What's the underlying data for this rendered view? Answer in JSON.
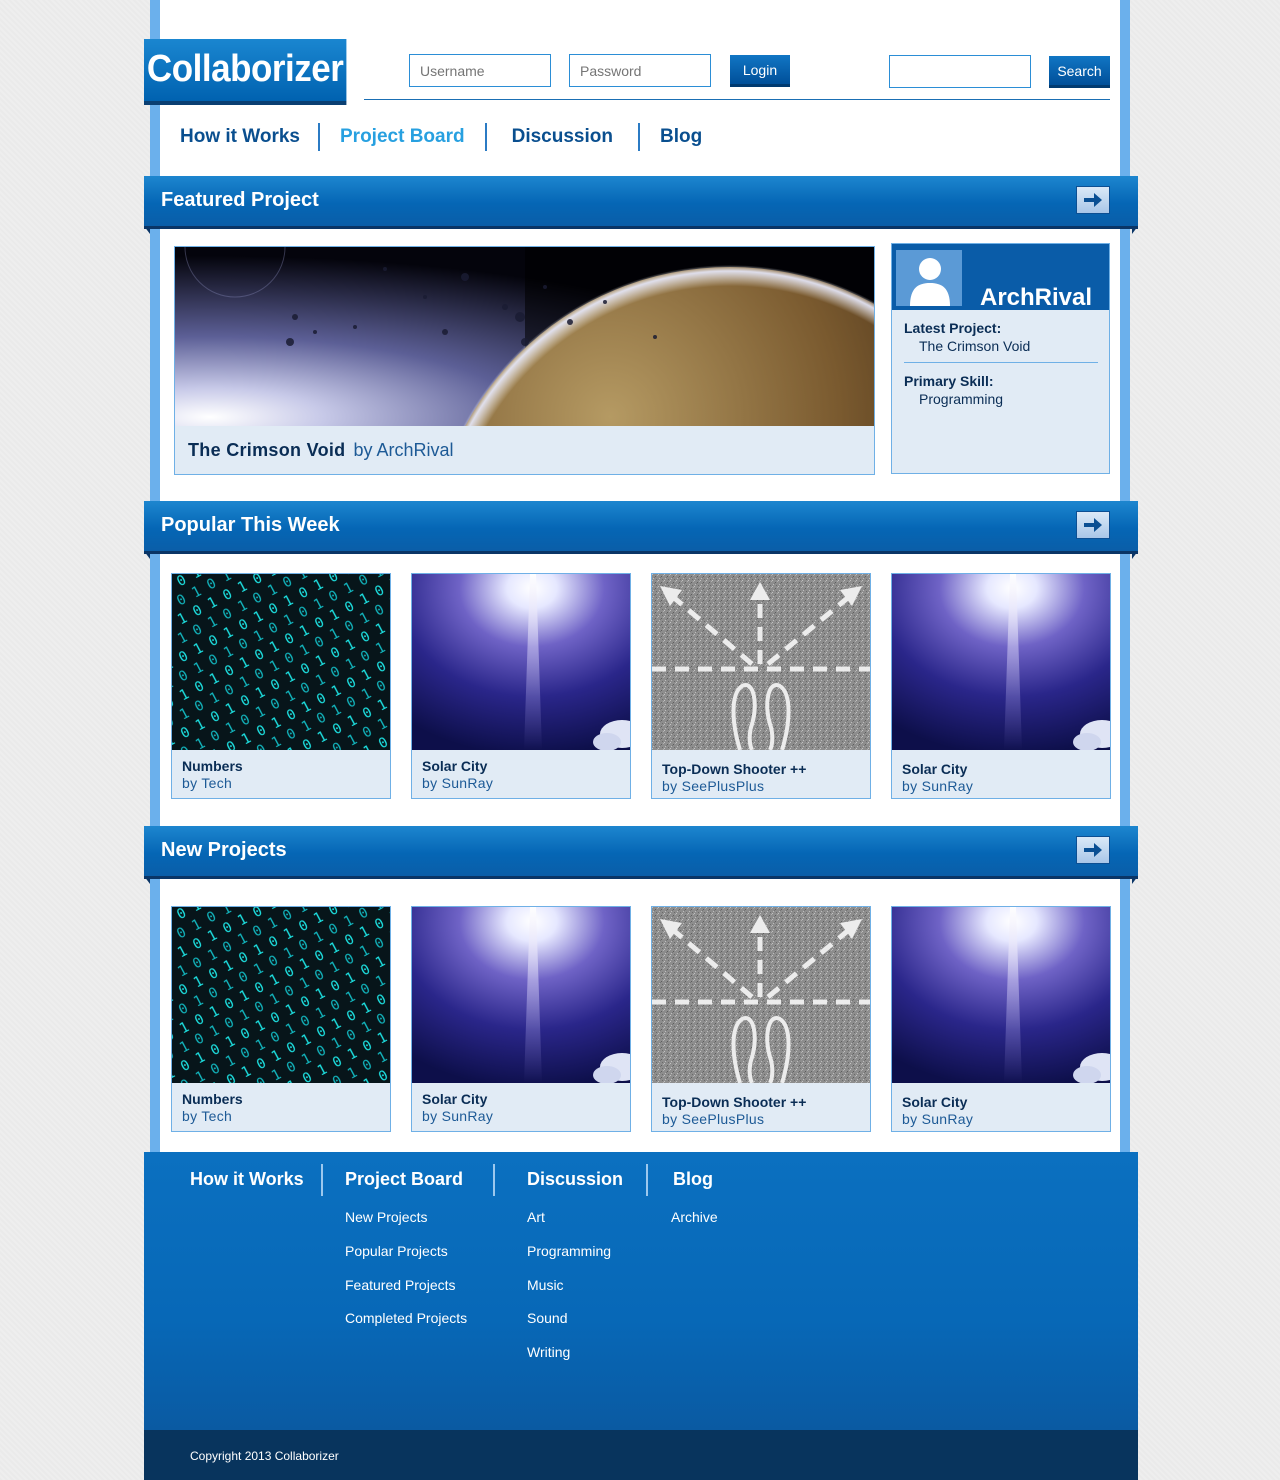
{
  "brand": {
    "name": "Collaborizer"
  },
  "login": {
    "username_placeholder": "Username",
    "password_placeholder": "Password",
    "login_label": "Login"
  },
  "search": {
    "placeholder": "",
    "button_label": "Search"
  },
  "nav": {
    "items": [
      {
        "label": "How it Works",
        "active": false
      },
      {
        "label": "Project Board",
        "active": true
      },
      {
        "label": "Discussion",
        "active": false
      },
      {
        "label": "Blog",
        "active": false
      }
    ]
  },
  "featured": {
    "section_title": "Featured Project",
    "project_title": "The Crimson Void",
    "project_by": "by ArchRival",
    "profile": {
      "name": "ArchRival",
      "latest_project_label": "Latest Project:",
      "latest_project_value": "The Crimson Void",
      "primary_skill_label": "Primary Skill:",
      "primary_skill_value": "Programming"
    }
  },
  "popular": {
    "section_title": "Popular This Week",
    "cards": [
      {
        "title": "Numbers",
        "by": "by Tech",
        "image": "binary-code-image"
      },
      {
        "title": "Solar City",
        "by": "by SunRay",
        "image": "sun-rays-image"
      },
      {
        "title": "Top-Down Shooter ++",
        "by": "by SeePlusPlus",
        "image": "road-arrows-image"
      },
      {
        "title": "Solar City",
        "by": "by SunRay",
        "image": "sun-rays-image"
      }
    ]
  },
  "new_projects": {
    "section_title": "New Projects",
    "cards": [
      {
        "title": "Numbers",
        "by": "by Tech",
        "image": "binary-code-image"
      },
      {
        "title": "Solar City",
        "by": "by SunRay",
        "image": "sun-rays-image"
      },
      {
        "title": "Top-Down Shooter ++",
        "by": "by SeePlusPlus",
        "image": "road-arrows-image"
      },
      {
        "title": "Solar City",
        "by": "by SunRay",
        "image": "sun-rays-image"
      }
    ]
  },
  "footer": {
    "columns": [
      {
        "heading": "How it Works",
        "links": []
      },
      {
        "heading": "Project Board",
        "links": [
          "New Projects",
          "Popular Projects",
          "Featured Projects",
          "Completed Projects"
        ]
      },
      {
        "heading": "Discussion",
        "links": [
          "Art",
          "Programming",
          "Music",
          "Sound",
          "Writing"
        ]
      },
      {
        "heading": "Blog",
        "links": [
          "Archive"
        ]
      }
    ],
    "copyright": "Copyright 2013 Collaborizer"
  },
  "colors": {
    "primary_blue": "#0566b5",
    "frame_light_blue": "#6bb0ec",
    "nav_active": "#27a0e0",
    "card_bg": "#e1ebf5",
    "footer_dark": "#08345d"
  }
}
